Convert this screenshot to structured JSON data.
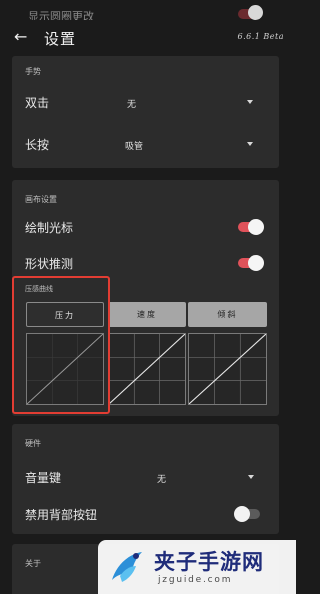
{
  "ghost_row": {
    "label": "显示圆圈更改"
  },
  "header": {
    "title": "设置",
    "version": "6.6.1 Beta"
  },
  "gestures": {
    "section_title": "手势",
    "double_tap": {
      "label": "双击",
      "value": "无"
    },
    "long_press": {
      "label": "长按",
      "value": "吸管"
    }
  },
  "canvas_settings": {
    "section_title": "画布设置",
    "draw_cursor": {
      "label": "绘制光标",
      "enabled": true
    },
    "shape_predict": {
      "label": "形状推测",
      "enabled": true
    },
    "pressure_curve": {
      "title": "压感曲线",
      "tabs": [
        {
          "label": "压力",
          "selected": true
        },
        {
          "label": "速度",
          "selected": false
        },
        {
          "label": "倾斜",
          "selected": false
        }
      ]
    }
  },
  "hardware": {
    "section_title": "硬件",
    "volume_keys": {
      "label": "音量键",
      "value": "无"
    },
    "disable_back_button": {
      "label": "禁用背部按钮",
      "enabled": false
    }
  },
  "about": {
    "section_title": "关于"
  },
  "watermark": {
    "brand": "夹子手游网",
    "url": "jzguide.com"
  },
  "colors": {
    "accent": "#e0525a",
    "card": "#2c2c2c",
    "background": "#1b1b1b",
    "highlight": "#e23d33"
  }
}
